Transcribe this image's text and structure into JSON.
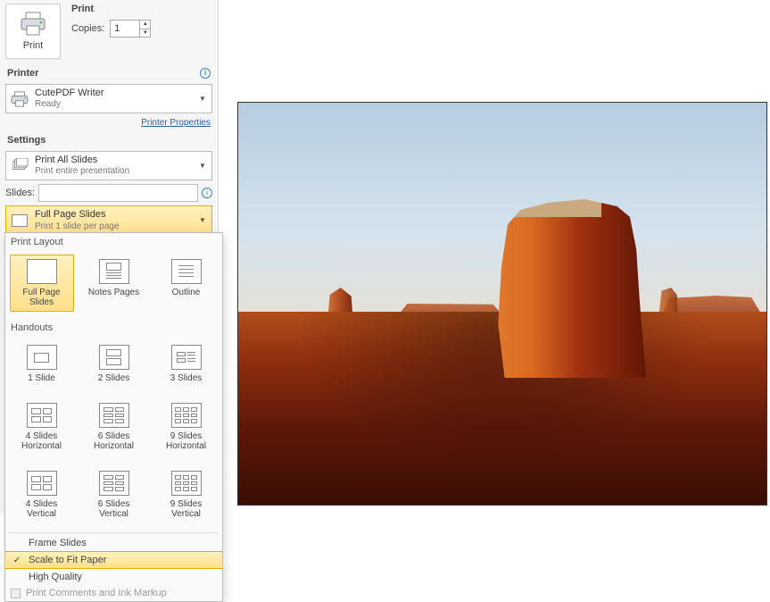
{
  "title": "Print",
  "print_button_label": "Print",
  "copies_label": "Copies:",
  "copies_value": "1",
  "printer_heading": "Printer",
  "printer": {
    "name": "CutePDF Writer",
    "status": "Ready"
  },
  "printer_properties_link": "Printer Properties",
  "settings_heading": "Settings",
  "print_what": {
    "title": "Print All Slides",
    "subtitle": "Print entire presentation"
  },
  "slides_label": "Slides:",
  "slides_value": "",
  "layout_selected": {
    "title": "Full Page Slides",
    "subtitle": "Print 1 slide per page"
  },
  "dropdown": {
    "print_layout_heading": "Print Layout",
    "layout_items": [
      {
        "label": "Full Page Slides",
        "selected": true
      },
      {
        "label": "Notes Pages",
        "selected": false
      },
      {
        "label": "Outline",
        "selected": false
      }
    ],
    "handouts_heading": "Handouts",
    "handout_items_row1": [
      {
        "label": "1 Slide"
      },
      {
        "label": "2 Slides"
      },
      {
        "label": "3 Slides"
      }
    ],
    "handout_items_row2": [
      {
        "label": "4 Slides Horizontal"
      },
      {
        "label": "6 Slides Horizontal"
      },
      {
        "label": "9 Slides Horizontal"
      }
    ],
    "handout_items_row3": [
      {
        "label": "4 Slides Vertical"
      },
      {
        "label": "6 Slides Vertical"
      },
      {
        "label": "9 Slides Vertical"
      }
    ],
    "options": [
      {
        "label": "Frame Slides",
        "checked": false,
        "highlighted": false,
        "enabled": true
      },
      {
        "label": "Scale to Fit Paper",
        "checked": true,
        "highlighted": true,
        "enabled": true
      },
      {
        "label": "High Quality",
        "checked": false,
        "highlighted": false,
        "enabled": true
      },
      {
        "label": "Print Comments and Ink Markup",
        "checked": false,
        "highlighted": false,
        "enabled": false
      }
    ]
  }
}
